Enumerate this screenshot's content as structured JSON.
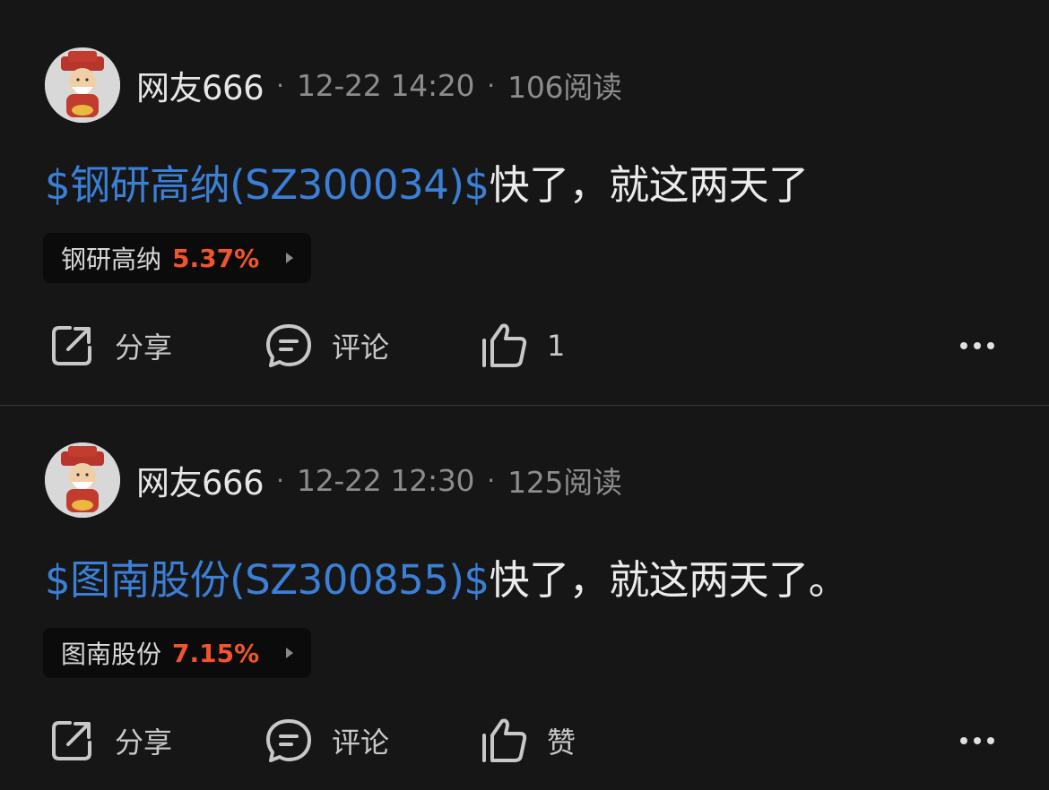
{
  "posts": [
    {
      "username": "网友666",
      "time": "12-22 14:20",
      "reads": "106阅读",
      "stock_link": "$钢研高纳(SZ300034)$",
      "text": "快了，就这两天了",
      "ticker": {
        "name": "钢研高纳",
        "change": "5.37%"
      },
      "actions": {
        "share": "分享",
        "comment": "评论",
        "like": "1"
      }
    },
    {
      "username": "网友666",
      "time": "12-22 12:30",
      "reads": "125阅读",
      "stock_link": "$图南股份(SZ300855)$",
      "text": "快了，就这两天了。",
      "ticker": {
        "name": "图南股份",
        "change": "7.15%"
      },
      "actions": {
        "share": "分享",
        "comment": "评论",
        "like": "赞"
      }
    }
  ],
  "colors": {
    "background": "#161616",
    "link": "#3b7fd6",
    "rise": "#f2542d"
  },
  "icons": [
    "avatar-image",
    "share-icon",
    "comment-icon",
    "like-icon",
    "more-icon",
    "chevron-right-icon"
  ]
}
